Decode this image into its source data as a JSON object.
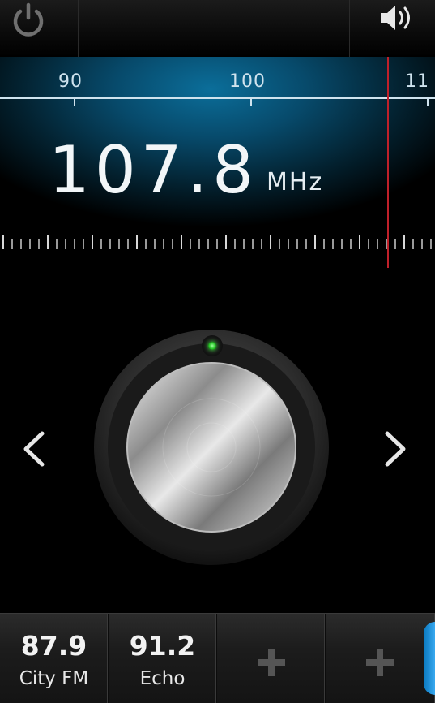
{
  "toolbar": {
    "power_icon": "power-icon",
    "volume_icon": "speaker-volume-icon"
  },
  "tuner": {
    "scale_labels": [
      "90",
      "100",
      "11"
    ],
    "frequency": "107.8",
    "unit": "MHz",
    "needle_color": "#c0202a"
  },
  "navigation": {
    "prev_icon": "chevron-left-icon",
    "next_icon": "chevron-right-icon"
  },
  "knob": {
    "indicator": "green-led-icon"
  },
  "presets": [
    {
      "freq": "87.9",
      "name": "City FM"
    },
    {
      "freq": "91.2",
      "name": "Echo"
    },
    {
      "add_icon": "plus-icon"
    },
    {
      "add_icon": "plus-icon"
    }
  ],
  "colors": {
    "accent": "#0b6e9a",
    "glow": "#39a9f0",
    "led": "#23c323"
  }
}
